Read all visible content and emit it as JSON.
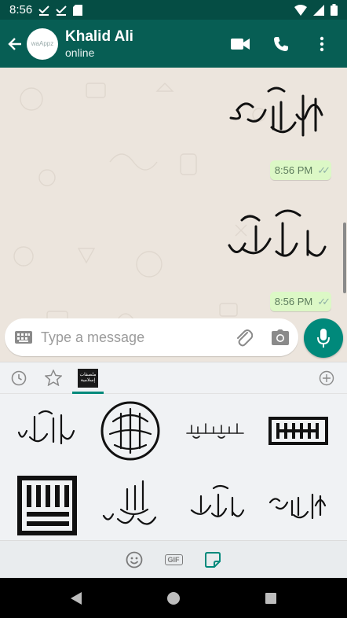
{
  "status_bar": {
    "time": "8:56"
  },
  "header": {
    "contact_name": "Khalid Ali",
    "contact_status": "online",
    "avatar_text": "waAppz"
  },
  "messages": [
    {
      "type": "sticker",
      "sticker_icon": "calligraphy-subhanallah",
      "time": "8:56 PM",
      "status": "read"
    },
    {
      "type": "sticker",
      "sticker_icon": "calligraphy-rabbi-zidni-ilma",
      "time": "8:56 PM",
      "status": "read"
    }
  ],
  "composer": {
    "placeholder": "Type a message"
  },
  "sticker_panel": {
    "pack_label": "ملصقات إسلامية",
    "grid": [
      "calligraphy-alhamdulillah",
      "calligraphy-circular",
      "calligraphy-basmala-line",
      "calligraphy-kufic-square",
      "calligraphy-kufic-block",
      "calligraphy-astaghfirullah",
      "calligraphy-rabbi-zidni-ilma",
      "calligraphy-subhanallah"
    ],
    "footer": {
      "gif_label": "GIF"
    }
  },
  "colors": {
    "primary": "#075e54",
    "accent": "#00897b",
    "bubble": "#dcf8c6",
    "chat_bg": "#ece5dd"
  }
}
